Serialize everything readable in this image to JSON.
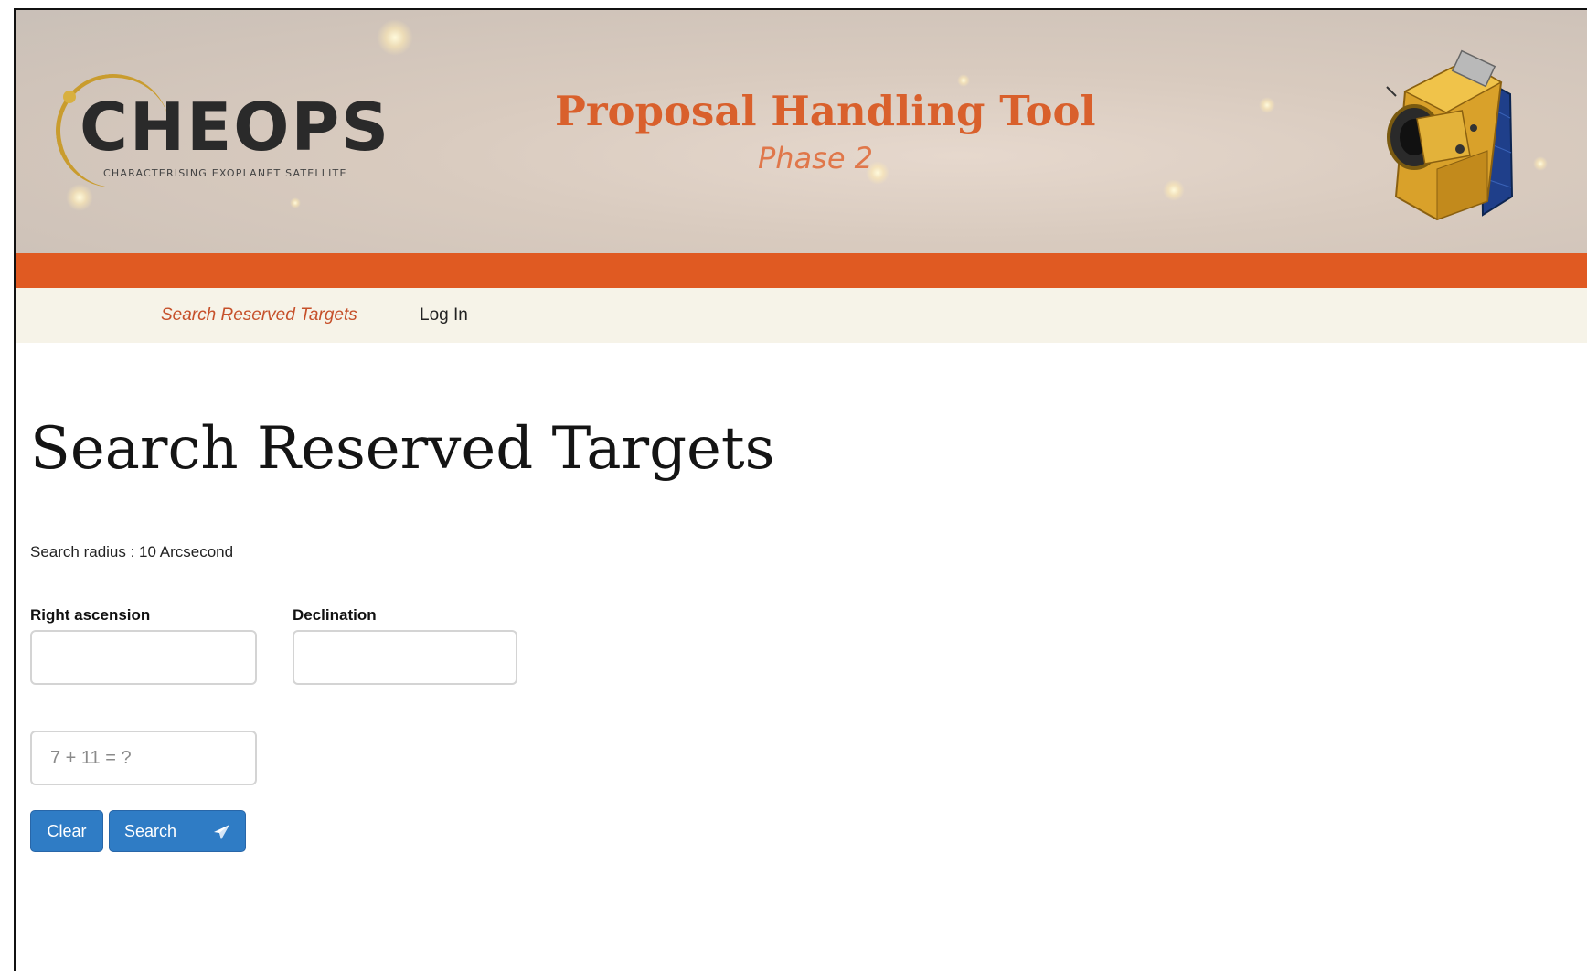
{
  "header": {
    "logo_text": "CHEOPS",
    "logo_subtitle": "CHARACTERISING EXOPLANET SATELLITE",
    "tool_title": "Proposal Handling Tool",
    "tool_subtitle": "Phase 2",
    "accent_color": "#e05a22",
    "satellite_icon": "satellite-icon"
  },
  "nav": {
    "items": [
      {
        "label": "Search Reserved Targets",
        "active": true
      },
      {
        "label": "Log In",
        "active": false
      }
    ]
  },
  "main": {
    "title": "Search Reserved Targets",
    "search_radius_text": "Search radius : 10 Arcsecond",
    "fields": {
      "ra": {
        "label": "Right ascension",
        "value": ""
      },
      "dec": {
        "label": "Declination",
        "value": ""
      },
      "captcha": {
        "placeholder": "7 + 11 = ?",
        "value": ""
      }
    },
    "buttons": {
      "clear_label": "Clear",
      "search_label": "Search",
      "search_icon": "send-icon",
      "button_color": "#2f7cc5"
    }
  }
}
